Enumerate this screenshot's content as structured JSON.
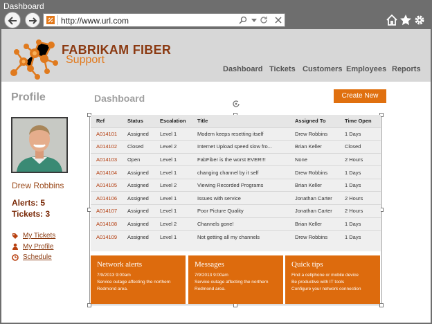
{
  "window": {
    "title": "Dashboard"
  },
  "browser": {
    "url": "http://www.url.com",
    "icons": [
      "back-arrow-icon",
      "forward-arrow-icon",
      "search-icon",
      "dropdown-icon",
      "refresh-icon",
      "close-icon",
      "home-icon",
      "star-icon",
      "gear-icon"
    ]
  },
  "brand": {
    "name": "FABRIKAM FIBER",
    "product": "Support",
    "color": "#e2781a"
  },
  "nav": [
    "Dashboard",
    "Tickets",
    "Customers",
    "Employees",
    "Reports"
  ],
  "profile": {
    "heading": "Profile",
    "name": "Drew Robbins",
    "alerts": "Alerts: 5",
    "tickets": "Tickets: 3",
    "links": [
      "My Tickets",
      "My Profile",
      "Schedule"
    ]
  },
  "dashboard": {
    "heading": "Dashboard",
    "create_label": "Create New",
    "columns": [
      "Ref",
      "Status",
      "Escalation",
      "Title",
      "Assigned To",
      "Time Open"
    ],
    "rows": [
      [
        "A014101",
        "Assigned",
        "Level 1",
        "Modem keeps resetting itself",
        "Drew Robbins",
        "1 Days"
      ],
      [
        "A014102",
        "Closed",
        "Level 2",
        "Internet Upload speed slow fro...",
        "Brian Keller",
        "Closed"
      ],
      [
        "A014103",
        "Open",
        "Level 1",
        "FabFiber is the worst EVER!!!",
        "None",
        "2 Hours"
      ],
      [
        "A014104",
        "Assigned",
        "Level 1",
        "changing channel by it self",
        "Drew Robbins",
        "1 Days"
      ],
      [
        "A014105",
        "Assigned",
        "Level 2",
        "Viewing Recorded Programs",
        "Brian Keller",
        "1 Days"
      ],
      [
        "A014106",
        "Assigned",
        "Level 1",
        "Issues with service",
        "Jonathan Carter",
        "2 Hours"
      ],
      [
        "A014107",
        "Assigned",
        "Level 1",
        "Poor Picture Quality",
        "Jonathan Carter",
        "2 Hours"
      ],
      [
        "A014108",
        "Assigned",
        "Level 2",
        "Channels gone!",
        "Brian Keller",
        "1 Days"
      ],
      [
        "A014109",
        "Assigned",
        "Level 1",
        "Not getting all my channels",
        "Drew Robbins",
        "1 Days"
      ]
    ]
  },
  "tiles": [
    {
      "title": "Network alerts",
      "lines": [
        "7/9/2013 9:00am",
        "Service outage affecting the northern Redmond area."
      ]
    },
    {
      "title": "Messages",
      "lines": [
        "7/9/2013 9:00am",
        "Service outage affecting the northern Redmond area."
      ]
    },
    {
      "title": "Quick tips",
      "lines": [
        "Find a cellphone or mobile device",
        "Be productive with IT tools",
        "Configure your network connection"
      ]
    }
  ]
}
